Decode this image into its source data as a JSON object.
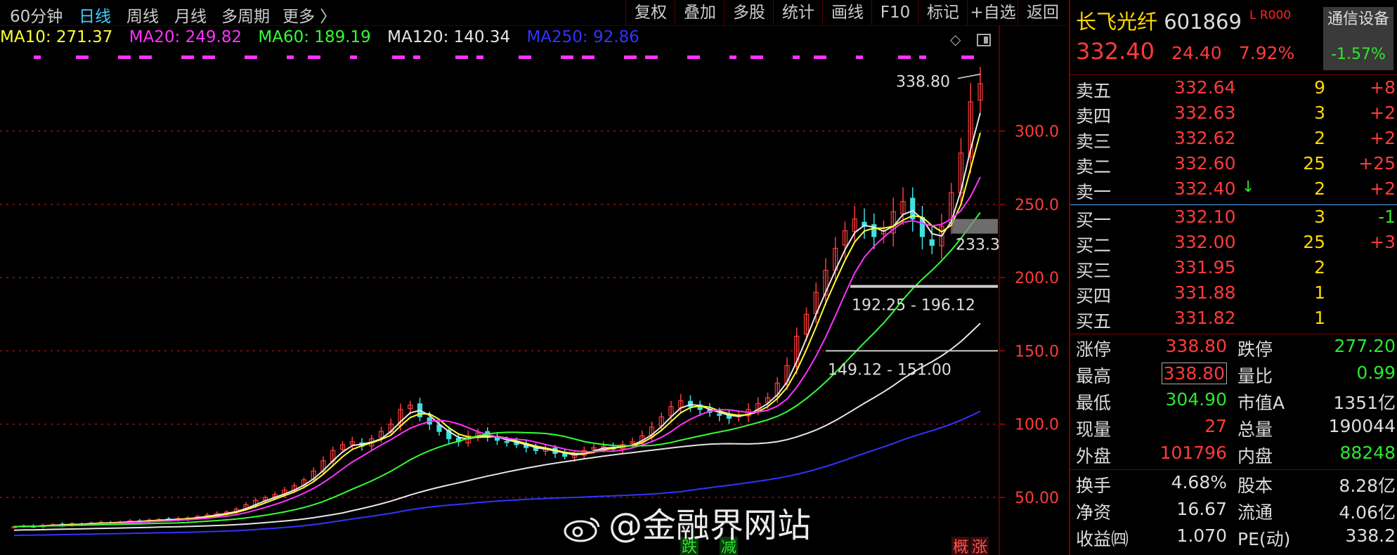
{
  "toolbar": {
    "tabs": [
      {
        "label": "60分钟",
        "active": false
      },
      {
        "label": "日线",
        "active": true
      },
      {
        "label": "周线",
        "active": false
      },
      {
        "label": "月线",
        "active": false
      },
      {
        "label": "多周期",
        "active": false
      },
      {
        "label": "更多 〉",
        "active": false
      }
    ],
    "buttons": [
      "复权",
      "叠加",
      "多股",
      "统计",
      "画线",
      "F10",
      "标记",
      "+自选",
      "返回"
    ]
  },
  "ma_legend": [
    {
      "label": "MA10: 271.37",
      "color": "#ffff33"
    },
    {
      "label": "MA20: 249.82",
      "color": "#ff33ff"
    },
    {
      "label": "MA60: 189.19",
      "color": "#33ff33"
    },
    {
      "label": "MA120: 140.34",
      "color": "#e6e6e6"
    },
    {
      "label": "MA250: 92.86",
      "color": "#3333ff"
    }
  ],
  "chart_data": {
    "type": "candlestick",
    "y_ticks": [
      "300.0",
      "250.0",
      "200.0",
      "150.0",
      "100.0",
      "50.00"
    ],
    "y_tick_values": [
      300,
      250,
      200,
      150,
      100,
      50
    ],
    "ylim": [
      15,
      353
    ],
    "annotations": {
      "high_label": "338.80",
      "level_label_1": "233.3",
      "range_label_1": "192.25 - 196.12",
      "range_label_2": "149.12 - 151.00"
    },
    "markers": [
      {
        "text": "跌",
        "color": "#2ee62e"
      },
      {
        "text": "减",
        "color": "#2ee62e"
      },
      {
        "text": "概",
        "color": "#ff5555"
      },
      {
        "text": "涨",
        "color": "#ff5555"
      }
    ],
    "close_series": [
      30,
      30.5,
      30.2,
      31,
      31.5,
      31.2,
      32,
      31.8,
      32.5,
      33,
      32.6,
      33.2,
      34,
      33.6,
      34.5,
      35,
      34.8,
      35.5,
      36,
      37,
      38,
      39,
      40,
      42,
      45,
      48,
      50,
      52,
      55,
      58,
      62,
      68,
      75,
      82,
      86,
      88,
      85,
      90,
      95,
      100,
      110,
      113,
      105,
      100,
      95,
      90,
      88,
      92,
      94,
      91,
      89,
      88,
      86,
      84,
      82,
      83,
      80,
      78,
      79,
      82,
      84,
      85,
      83,
      86,
      88,
      92,
      98,
      105,
      112,
      116,
      112,
      110,
      108,
      106,
      104,
      106,
      110,
      114,
      118,
      128,
      140,
      160,
      175,
      190,
      205,
      220,
      232,
      240,
      235,
      228,
      232,
      245,
      252,
      240,
      228,
      222,
      235,
      258,
      285,
      320,
      332.4
    ]
  },
  "quote": {
    "name": "长飞光纤",
    "code": "601869",
    "badge": "L R000",
    "price": "332.40",
    "change": "24.40",
    "change_pct": "7.92%",
    "sector_name": "通信设备",
    "sector_pct": "-1.57%",
    "asks": [
      {
        "label": "卖五",
        "price": "332.64",
        "vol": "9",
        "delta": "+8"
      },
      {
        "label": "卖四",
        "price": "332.63",
        "vol": "3",
        "delta": "+2"
      },
      {
        "label": "卖三",
        "price": "332.62",
        "vol": "2",
        "delta": "+2"
      },
      {
        "label": "卖二",
        "price": "332.60",
        "vol": "25",
        "delta": "+25"
      },
      {
        "label": "卖一",
        "price": "332.40",
        "vol": "2",
        "delta": "+2",
        "arrow": "↓"
      }
    ],
    "bids": [
      {
        "label": "买一",
        "price": "332.10",
        "vol": "3",
        "delta": "-1"
      },
      {
        "label": "买二",
        "price": "332.00",
        "vol": "25",
        "delta": "+3"
      },
      {
        "label": "买三",
        "price": "331.95",
        "vol": "2",
        "delta": ""
      },
      {
        "label": "买四",
        "price": "331.88",
        "vol": "1",
        "delta": ""
      },
      {
        "label": "买五",
        "price": "331.82",
        "vol": "1",
        "delta": ""
      }
    ],
    "stats": [
      {
        "l1": "涨停",
        "v1": "338.80",
        "l2": "跌停",
        "v2": "277.20"
      },
      {
        "l1": "最高",
        "v1": "338.80",
        "l2": "量比",
        "v2": "0.99"
      },
      {
        "l1": "最低",
        "v1": "304.90",
        "l2": "市值A",
        "v2": "1351亿"
      },
      {
        "l1": "现量",
        "v1": "27",
        "l2": "总量",
        "v2": "190044"
      },
      {
        "l1": "外盘",
        "v1": "101796",
        "l2": "内盘",
        "v2": "88248"
      },
      {
        "l1": "换手",
        "v1": "4.68%",
        "l2": "股本",
        "v2": "8.28亿"
      },
      {
        "l1": "净资",
        "v1": "16.67",
        "l2": "流通",
        "v2": "4.06亿"
      },
      {
        "l1": "收益㈣",
        "v1": "1.070",
        "l2": "PE(动)",
        "v2": "338.2"
      }
    ]
  },
  "watermark": "@金融界网站"
}
